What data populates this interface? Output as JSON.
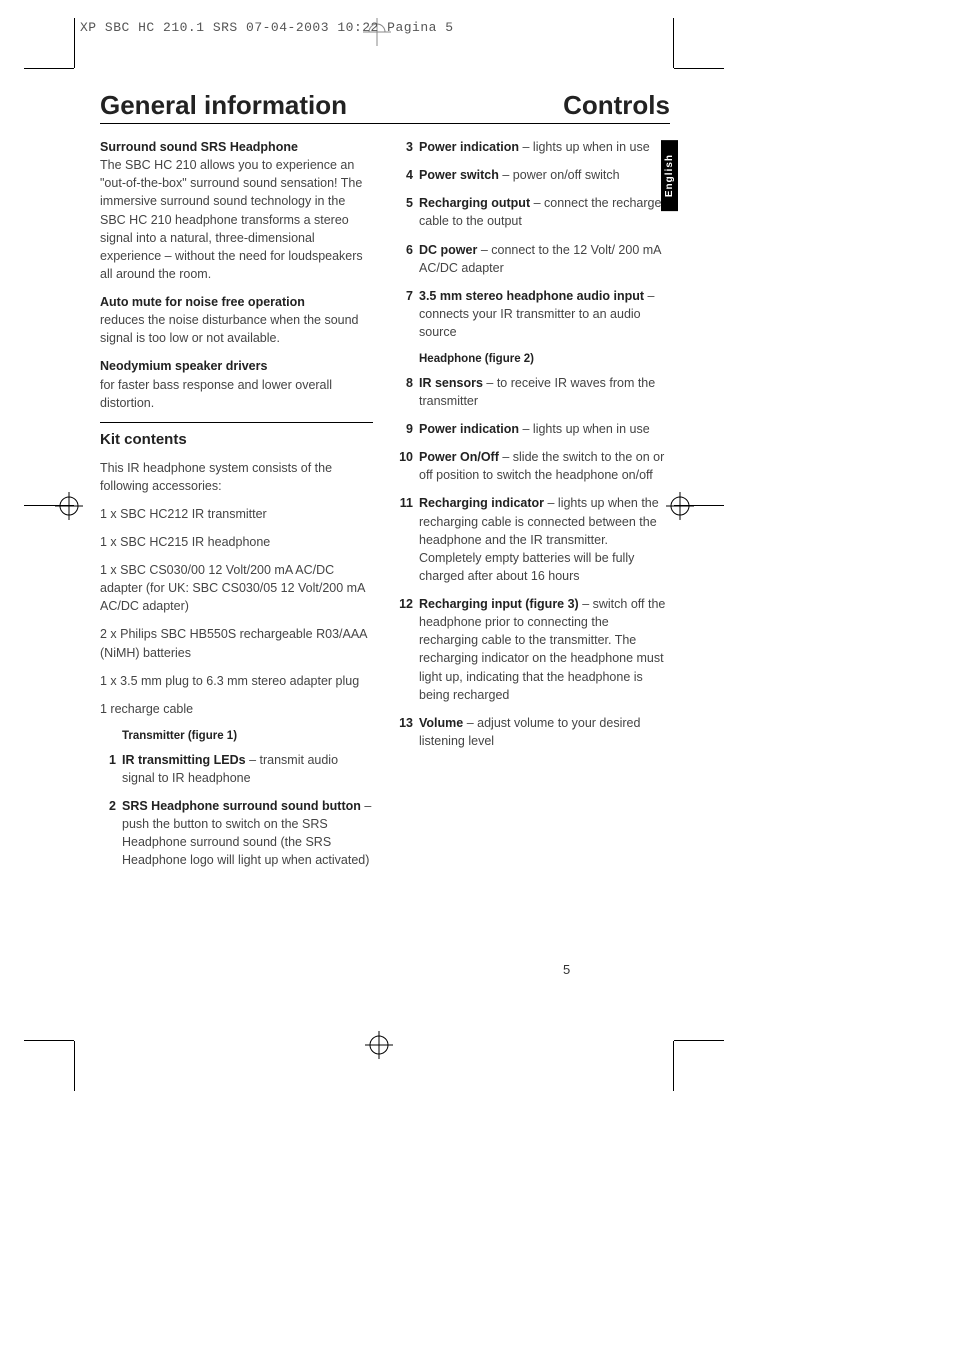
{
  "slug": "XP SBC HC 210.1 SRS  07-04-2003 10:22  Pagina 5",
  "lang_tab": "English",
  "page_number": "5",
  "heading_left": "General information",
  "heading_right": "Controls",
  "gen": {
    "h1": "Surround sound SRS Headphone",
    "p1": "The SBC HC 210 allows you to experience an \"out-of-the-box\" surround sound sensation! The immersive surround sound technology in the SBC HC 210 headphone transforms a stereo signal into a natural, three-dimensional experience – without the need for loudspeakers all around the room.",
    "h2": "Auto mute for noise free operation",
    "p2": "reduces the noise disturbance when the sound signal is too low or not available.",
    "h3": "Neodymium speaker drivers",
    "p3": "for faster bass response and lower overall distortion."
  },
  "kit": {
    "title": "Kit contents",
    "intro": "This IR headphone system consists of the following accessories:",
    "items": [
      "1 x SBC HC212 IR transmitter",
      "1 x SBC HC215 IR headphone",
      "1 x SBC CS030/00 12 Volt/200 mA AC/DC adapter (for UK: SBC CS030/05 12 Volt/200 mA AC/DC adapter)",
      "2 x Philips SBC HB550S rechargeable R03/AAA (NiMH) batteries",
      "1 x 3.5 mm plug to 6.3 mm stereo adapter plug",
      "1 recharge cable"
    ]
  },
  "tx": {
    "heading": "Transmitter (figure 1)",
    "i1b": "IR transmitting LEDs",
    "i1t": " – transmit audio signal to IR headphone",
    "i2b": "SRS Headphone surround sound button",
    "i2t": " – push the button to switch on the SRS Headphone surround sound (the SRS Headphone logo will light up when activated)"
  },
  "ctl": {
    "i3b": "Power indication",
    "i3t": " – lights up when in use",
    "i4b": "Power switch",
    "i4t": " – power on/off switch",
    "i5b": "Recharging output",
    "i5t": " – connect the recharge cable to the output",
    "i6b": "DC power",
    "i6t": " – connect to the 12 Volt/ 200 mA AC/DC adapter",
    "i7b": "3.5 mm stereo headphone audio input",
    "i7t": " – connects your IR transmitter to an audio source",
    "hp_heading": "Headphone (figure 2)",
    "i8b": "IR sensors",
    "i8t": " – to receive IR waves from the transmitter",
    "i9b": "Power indication",
    "i9t": " – lights up when in use",
    "i10b": "Power On/Off",
    "i10t": " – slide the switch to the on or off position to switch the headphone on/off",
    "i11b": "Recharging indicator",
    "i11t": " – lights up when the recharging cable is connected between the headphone and the IR transmitter. Completely empty batteries will be fully charged after about 16 hours",
    "i12b": "Recharging input (figure 3)",
    "i12t": " – switch off the headphone prior to connecting the recharging cable to the transmitter. The recharging indicator on the headphone must light up, indicating that the headphone is being recharged",
    "i13b": "Volume",
    "i13t": " – adjust volume to your desired listening level"
  },
  "nums": {
    "n1": "1",
    "n2": "2",
    "n3": "3",
    "n4": "4",
    "n5": "5",
    "n6": "6",
    "n7": "7",
    "n8": "8",
    "n9": "9",
    "n10": "10",
    "n11": "11",
    "n12": "12",
    "n13": "13"
  }
}
